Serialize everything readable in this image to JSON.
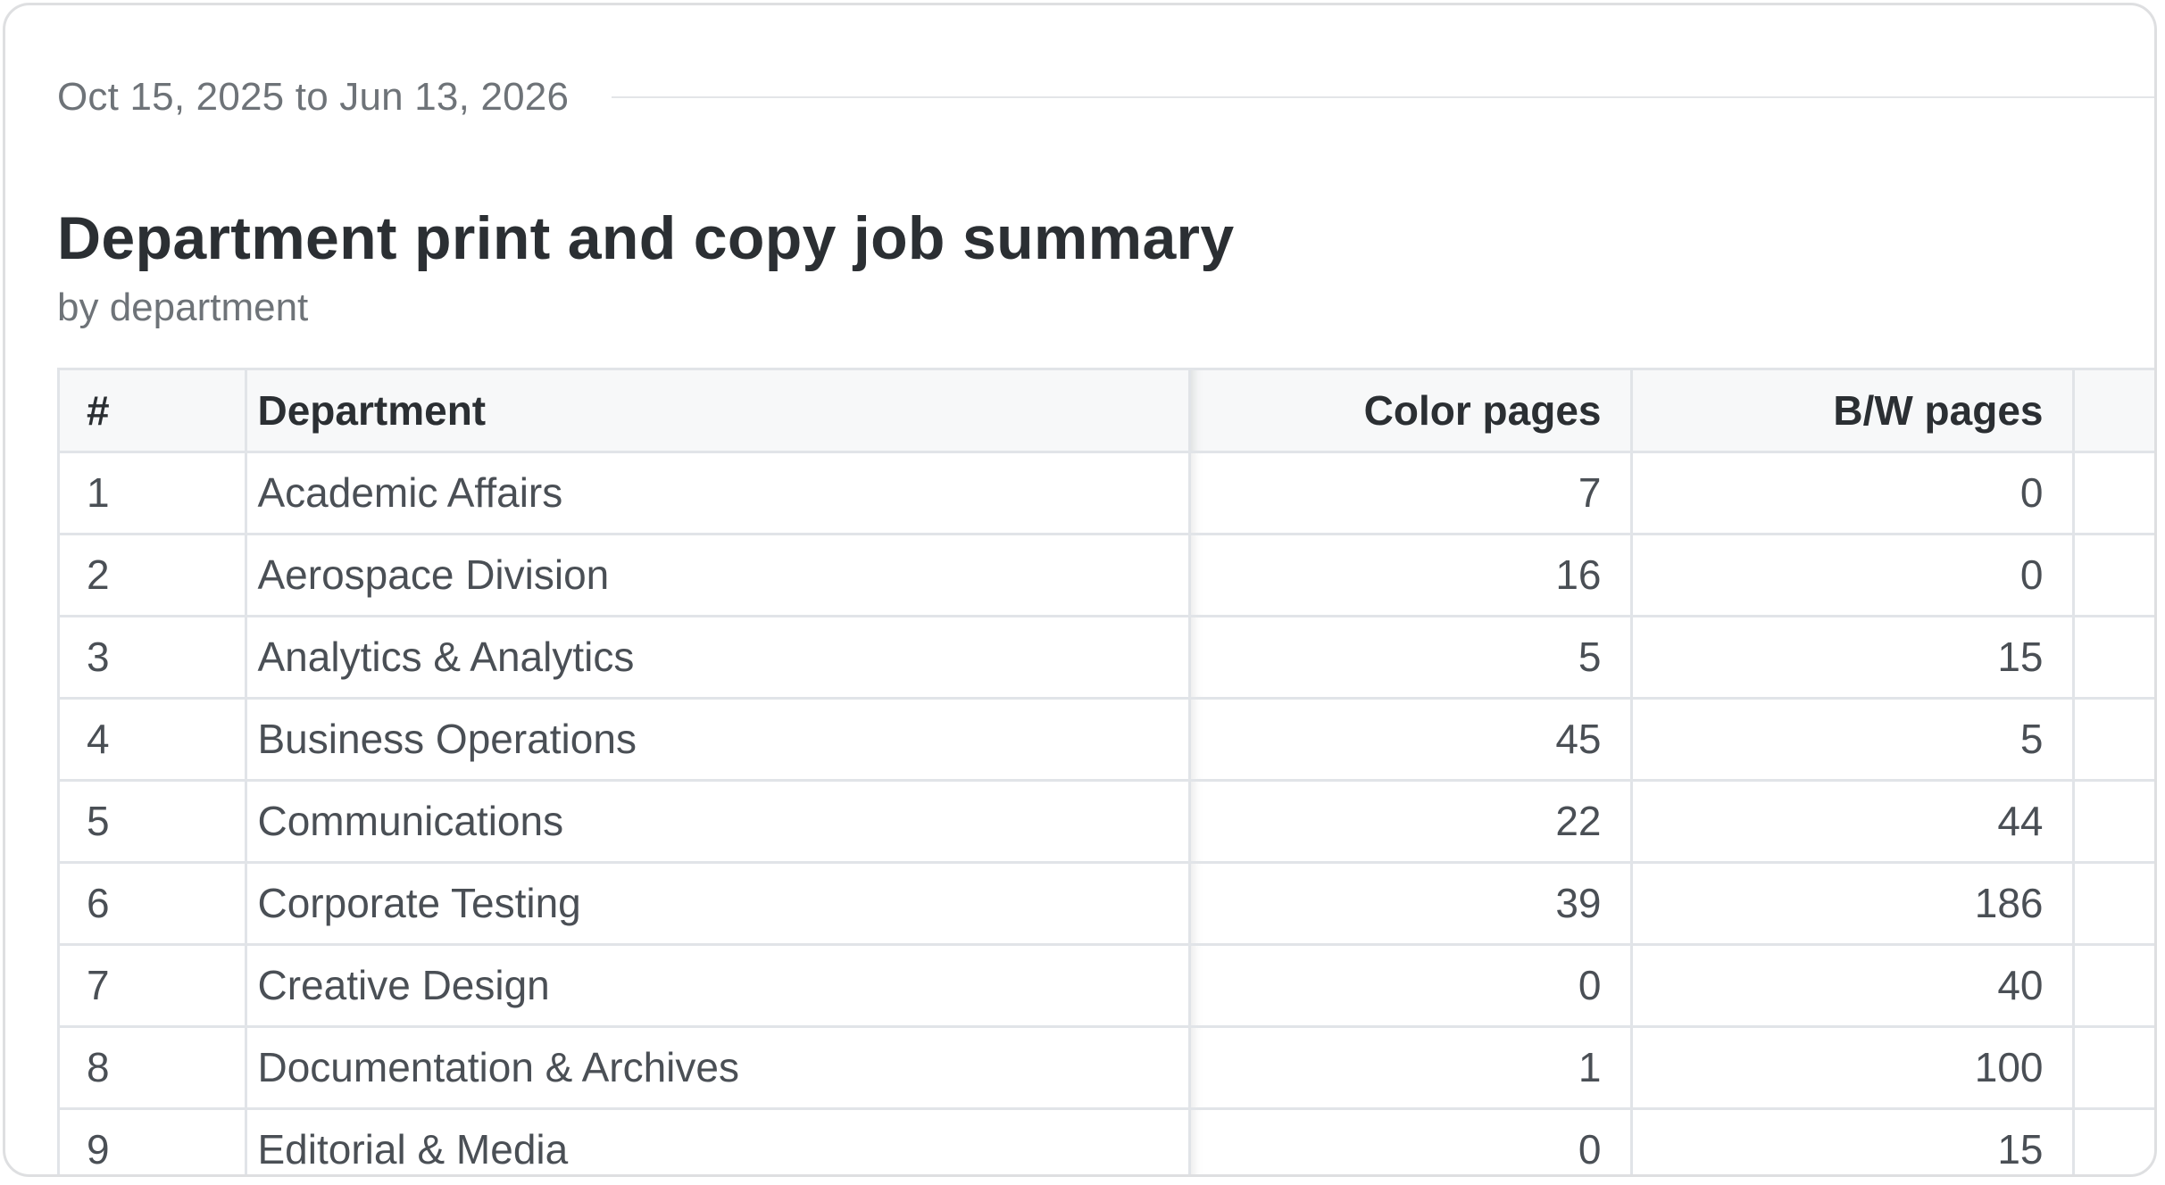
{
  "report": {
    "date_range": "Oct 15, 2025 to Jun 13, 2026",
    "title": "Department print and copy job summary",
    "subtitle": "by department"
  },
  "table": {
    "headers": {
      "num": "#",
      "department": "Department",
      "color_pages": "Color pages",
      "bw_pages": "B/W pages"
    },
    "rows": [
      {
        "num": "1",
        "department": "Academic Affairs",
        "color_pages": "7",
        "bw_pages": "0"
      },
      {
        "num": "2",
        "department": "Aerospace Division",
        "color_pages": "16",
        "bw_pages": "0"
      },
      {
        "num": "3",
        "department": "Analytics & Analytics",
        "color_pages": "5",
        "bw_pages": "15"
      },
      {
        "num": "4",
        "department": "Business Operations",
        "color_pages": "45",
        "bw_pages": "5"
      },
      {
        "num": "5",
        "department": "Communications",
        "color_pages": "22",
        "bw_pages": "44"
      },
      {
        "num": "6",
        "department": "Corporate Testing",
        "color_pages": "39",
        "bw_pages": "186"
      },
      {
        "num": "7",
        "department": "Creative Design",
        "color_pages": "0",
        "bw_pages": "40"
      },
      {
        "num": "8",
        "department": "Documentation & Archives",
        "color_pages": "1",
        "bw_pages": "100"
      },
      {
        "num": "9",
        "department": "Editorial & Media",
        "color_pages": "0",
        "bw_pages": "15"
      }
    ]
  }
}
